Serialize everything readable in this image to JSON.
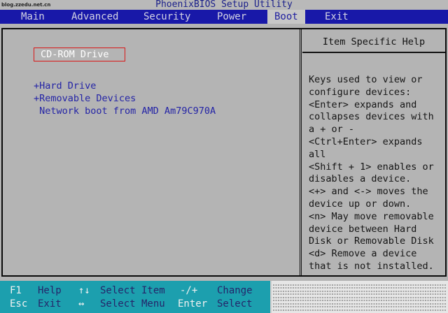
{
  "title": "PhoenixBIOS Setup Utility",
  "watermark": "blog.zzedu.net.cn",
  "menu": {
    "items": [
      {
        "label": "Main",
        "active": false
      },
      {
        "label": "Advanced",
        "active": false
      },
      {
        "label": "Security",
        "active": false
      },
      {
        "label": "Power",
        "active": false
      },
      {
        "label": "Boot",
        "active": true
      },
      {
        "label": "Exit",
        "active": false
      }
    ]
  },
  "boot_list": [
    {
      "label": "CD-ROM Drive",
      "selected": true
    },
    {
      "label": "+Hard Drive",
      "selected": false
    },
    {
      "label": "+Removable Devices",
      "selected": false
    },
    {
      "label": " Network boot from AMD Am79C970A",
      "selected": false
    }
  ],
  "help": {
    "header": "Item Specific Help",
    "lines": [
      "Keys used to view or",
      "configure devices:",
      "<Enter> expands and",
      "collapses devices with",
      "a + or -",
      "<Ctrl+Enter> expands",
      "all",
      "<Shift + 1> enables or",
      "disables a device.",
      "<+> and <-> moves the",
      "device up or down.",
      "<n> May move removable",
      "device between Hard",
      "Disk or Removable Disk",
      "<d> Remove a device",
      "that is not installed."
    ]
  },
  "footer": {
    "f1_key": "F1",
    "f1_desc": "Help",
    "updown_sym": "↑↓",
    "updown_desc": "Select Item",
    "plusminus_sym": "-/+",
    "plusminus_desc": "Change",
    "esc_key": "Esc",
    "esc_desc": "Exit",
    "leftright_sym": "↔",
    "leftright_desc": "Select Menu",
    "enter_key": "Enter",
    "enter_desc": "Select"
  },
  "colors": {
    "menubar": "#1818a8",
    "footer": "#1c9fae",
    "selection_border": "#d81818",
    "item_text": "#2424a6"
  }
}
